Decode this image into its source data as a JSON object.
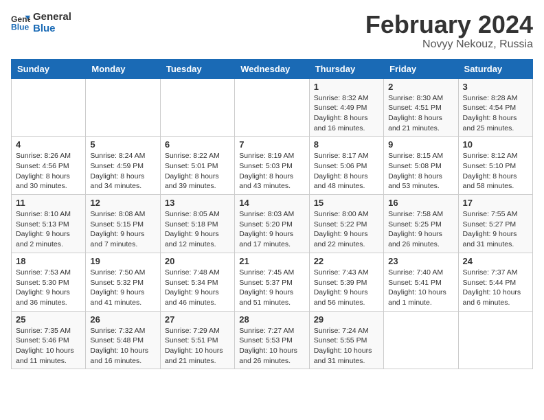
{
  "logo": {
    "line1": "General",
    "line2": "Blue"
  },
  "title": "February 2024",
  "subtitle": "Novyy Nekouz, Russia",
  "days_of_week": [
    "Sunday",
    "Monday",
    "Tuesday",
    "Wednesday",
    "Thursday",
    "Friday",
    "Saturday"
  ],
  "weeks": [
    [
      {
        "day": "",
        "info": ""
      },
      {
        "day": "",
        "info": ""
      },
      {
        "day": "",
        "info": ""
      },
      {
        "day": "",
        "info": ""
      },
      {
        "day": "1",
        "info": "Sunrise: 8:32 AM\nSunset: 4:49 PM\nDaylight: 8 hours\nand 16 minutes."
      },
      {
        "day": "2",
        "info": "Sunrise: 8:30 AM\nSunset: 4:51 PM\nDaylight: 8 hours\nand 21 minutes."
      },
      {
        "day": "3",
        "info": "Sunrise: 8:28 AM\nSunset: 4:54 PM\nDaylight: 8 hours\nand 25 minutes."
      }
    ],
    [
      {
        "day": "4",
        "info": "Sunrise: 8:26 AM\nSunset: 4:56 PM\nDaylight: 8 hours\nand 30 minutes."
      },
      {
        "day": "5",
        "info": "Sunrise: 8:24 AM\nSunset: 4:59 PM\nDaylight: 8 hours\nand 34 minutes."
      },
      {
        "day": "6",
        "info": "Sunrise: 8:22 AM\nSunset: 5:01 PM\nDaylight: 8 hours\nand 39 minutes."
      },
      {
        "day": "7",
        "info": "Sunrise: 8:19 AM\nSunset: 5:03 PM\nDaylight: 8 hours\nand 43 minutes."
      },
      {
        "day": "8",
        "info": "Sunrise: 8:17 AM\nSunset: 5:06 PM\nDaylight: 8 hours\nand 48 minutes."
      },
      {
        "day": "9",
        "info": "Sunrise: 8:15 AM\nSunset: 5:08 PM\nDaylight: 8 hours\nand 53 minutes."
      },
      {
        "day": "10",
        "info": "Sunrise: 8:12 AM\nSunset: 5:10 PM\nDaylight: 8 hours\nand 58 minutes."
      }
    ],
    [
      {
        "day": "11",
        "info": "Sunrise: 8:10 AM\nSunset: 5:13 PM\nDaylight: 9 hours\nand 2 minutes."
      },
      {
        "day": "12",
        "info": "Sunrise: 8:08 AM\nSunset: 5:15 PM\nDaylight: 9 hours\nand 7 minutes."
      },
      {
        "day": "13",
        "info": "Sunrise: 8:05 AM\nSunset: 5:18 PM\nDaylight: 9 hours\nand 12 minutes."
      },
      {
        "day": "14",
        "info": "Sunrise: 8:03 AM\nSunset: 5:20 PM\nDaylight: 9 hours\nand 17 minutes."
      },
      {
        "day": "15",
        "info": "Sunrise: 8:00 AM\nSunset: 5:22 PM\nDaylight: 9 hours\nand 22 minutes."
      },
      {
        "day": "16",
        "info": "Sunrise: 7:58 AM\nSunset: 5:25 PM\nDaylight: 9 hours\nand 26 minutes."
      },
      {
        "day": "17",
        "info": "Sunrise: 7:55 AM\nSunset: 5:27 PM\nDaylight: 9 hours\nand 31 minutes."
      }
    ],
    [
      {
        "day": "18",
        "info": "Sunrise: 7:53 AM\nSunset: 5:30 PM\nDaylight: 9 hours\nand 36 minutes."
      },
      {
        "day": "19",
        "info": "Sunrise: 7:50 AM\nSunset: 5:32 PM\nDaylight: 9 hours\nand 41 minutes."
      },
      {
        "day": "20",
        "info": "Sunrise: 7:48 AM\nSunset: 5:34 PM\nDaylight: 9 hours\nand 46 minutes."
      },
      {
        "day": "21",
        "info": "Sunrise: 7:45 AM\nSunset: 5:37 PM\nDaylight: 9 hours\nand 51 minutes."
      },
      {
        "day": "22",
        "info": "Sunrise: 7:43 AM\nSunset: 5:39 PM\nDaylight: 9 hours\nand 56 minutes."
      },
      {
        "day": "23",
        "info": "Sunrise: 7:40 AM\nSunset: 5:41 PM\nDaylight: 10 hours\nand 1 minute."
      },
      {
        "day": "24",
        "info": "Sunrise: 7:37 AM\nSunset: 5:44 PM\nDaylight: 10 hours\nand 6 minutes."
      }
    ],
    [
      {
        "day": "25",
        "info": "Sunrise: 7:35 AM\nSunset: 5:46 PM\nDaylight: 10 hours\nand 11 minutes."
      },
      {
        "day": "26",
        "info": "Sunrise: 7:32 AM\nSunset: 5:48 PM\nDaylight: 10 hours\nand 16 minutes."
      },
      {
        "day": "27",
        "info": "Sunrise: 7:29 AM\nSunset: 5:51 PM\nDaylight: 10 hours\nand 21 minutes."
      },
      {
        "day": "28",
        "info": "Sunrise: 7:27 AM\nSunset: 5:53 PM\nDaylight: 10 hours\nand 26 minutes."
      },
      {
        "day": "29",
        "info": "Sunrise: 7:24 AM\nSunset: 5:55 PM\nDaylight: 10 hours\nand 31 minutes."
      },
      {
        "day": "",
        "info": ""
      },
      {
        "day": "",
        "info": ""
      }
    ]
  ]
}
